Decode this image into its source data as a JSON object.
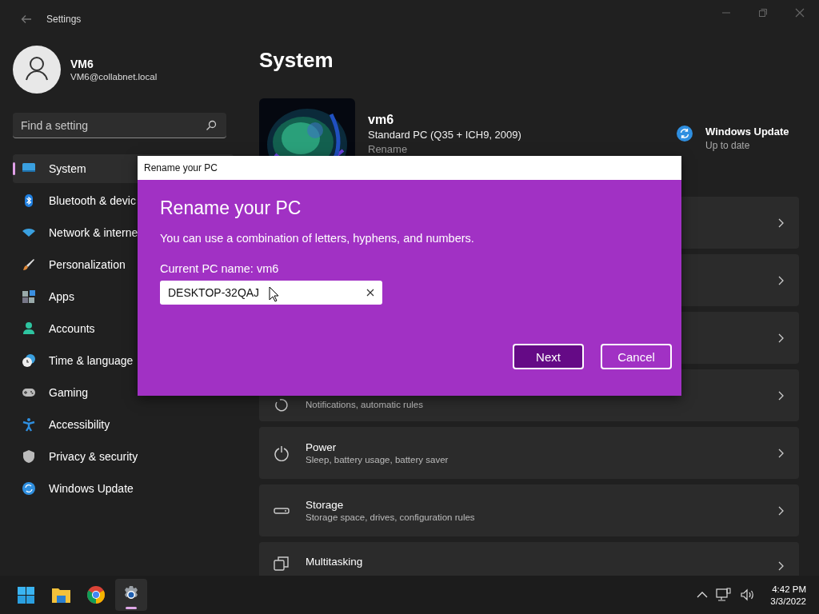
{
  "window": {
    "title": "Settings"
  },
  "account": {
    "name": "VM6",
    "email": "VM6@collabnet.local"
  },
  "search": {
    "placeholder": "Find a setting"
  },
  "nav": [
    {
      "label": "System",
      "selected": true
    },
    {
      "label": "Bluetooth & devic",
      "selected": false
    },
    {
      "label": "Network & interne",
      "selected": false
    },
    {
      "label": "Personalization",
      "selected": false
    },
    {
      "label": "Apps",
      "selected": false
    },
    {
      "label": "Accounts",
      "selected": false
    },
    {
      "label": "Time & language",
      "selected": false
    },
    {
      "label": "Gaming",
      "selected": false
    },
    {
      "label": "Accessibility",
      "selected": false
    },
    {
      "label": "Privacy & security",
      "selected": false
    },
    {
      "label": "Windows Update",
      "selected": false
    }
  ],
  "page_title": "System",
  "device": {
    "name": "vm6",
    "model": "Standard PC (Q35 + ICH9, 2009)",
    "rename_link": "Rename"
  },
  "update": {
    "title": "Windows Update",
    "status": "Up to date"
  },
  "cards": [
    {
      "kind": "covered"
    },
    {
      "kind": "covered"
    },
    {
      "kind": "covered"
    },
    {
      "kind": "partial",
      "subtitle": "Notifications, automatic rules"
    },
    {
      "kind": "full",
      "title": "Power",
      "subtitle": "Sleep, battery usage, battery saver"
    },
    {
      "kind": "full",
      "title": "Storage",
      "subtitle": "Storage space, drives, configuration rules"
    },
    {
      "kind": "full",
      "title": "Multitasking"
    }
  ],
  "dialog": {
    "title_bar": "Rename your PC",
    "heading": "Rename your PC",
    "description": "You can use a combination of letters, hyphens, and numbers.",
    "current_name": "Current PC name: vm6",
    "input_value": "DESKTOP-32QAJ",
    "buttons": [
      {
        "label": "Next",
        "kind": "primary"
      },
      {
        "label": "Cancel",
        "kind": "secondary"
      }
    ]
  },
  "taskbar": {
    "apps": [
      {
        "selected": false
      },
      {
        "selected": false
      },
      {
        "selected": false
      },
      {
        "selected": true
      }
    ],
    "clock": {
      "time": "4:42 PM",
      "date": "3/3/2022"
    }
  }
}
